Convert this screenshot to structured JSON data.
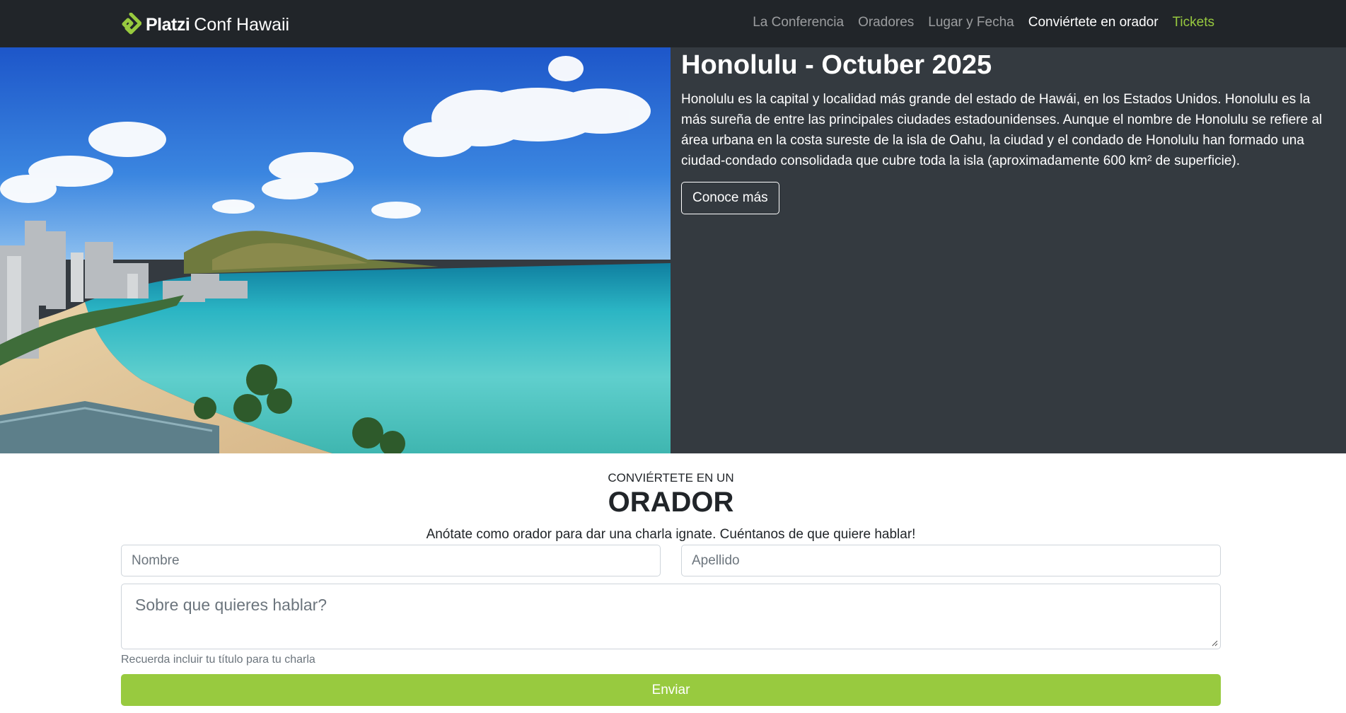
{
  "navbar": {
    "brand_platzi": "Platzi",
    "brand_rest": "Conf Hawaii",
    "links": [
      {
        "label": "La Conferencia"
      },
      {
        "label": "Oradores"
      },
      {
        "label": "Lugar y Fecha"
      },
      {
        "label": "Conviértete en orador"
      },
      {
        "label": "Tickets"
      }
    ],
    "colors": {
      "background": "#212529",
      "accent": "#98ca3f"
    }
  },
  "hero": {
    "title": "Honolulu - Octuber 2025",
    "description": "Honolulu es la capital y localidad más grande del estado de Hawái, en los Estados Unidos. Honolulu es la más sureña de entre las principales ciudades estadounidenses. Aunque el nombre de Honolulu se refiere al área urbana en la costa sureste de la isla de Oahu, la ciudad y el condado de Honolulu han formado una ciudad-condado consolidada que cubre toda la isla (aproximadamente 600 km² de superficie).",
    "button_label": "Conoce más",
    "background_color": "#343a40"
  },
  "speaker_form": {
    "kicker": "CONVIÉRTETE EN UN",
    "title": "ORADOR",
    "lead": "Anótate como orador para dar una charla ignate. Cuéntanos de que quiere hablar!",
    "first_name_placeholder": "Nombre",
    "last_name_placeholder": "Apellido",
    "topic_placeholder": "Sobre que quieres hablar?",
    "help_text": "Recuerda incluir tu título para tu charla",
    "submit_label": "Enviar",
    "submit_color": "#98ca3f"
  }
}
